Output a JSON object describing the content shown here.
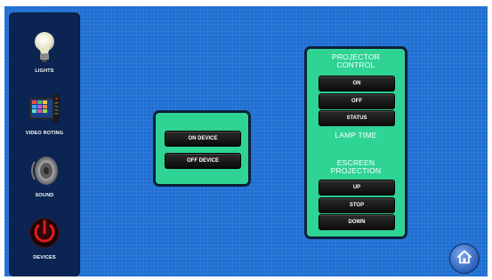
{
  "sidebar": {
    "items": [
      {
        "label": "LIGHTS",
        "icon": "light-bulb-icon"
      },
      {
        "label": "VIDEO ROTING",
        "icon": "tv-remote-icon"
      },
      {
        "label": "SOUND",
        "icon": "speaker-icon"
      },
      {
        "label": "DEVICES",
        "icon": "power-icon"
      }
    ]
  },
  "device_panel": {
    "on_label": "ON DEVICE",
    "off_label": "OFF DEVICE"
  },
  "projector_panel": {
    "title_line1": "PROJECTOR",
    "title_line2": "CONTROL",
    "on_label": "ON",
    "off_label": "OFF",
    "status_label": "STATUS",
    "lamp_time_label": "LAMP TIME",
    "screen_title_line1": "ESCREEN",
    "screen_title_line2": "PROJECTION",
    "up_label": "UP",
    "stop_label": "STOP",
    "down_label": "DOWN"
  },
  "home": {
    "icon": "home-icon"
  },
  "colors": {
    "background": "#1f6fd2",
    "sidebar": "#0b2452",
    "panel": "#2fd394",
    "button": "#111111"
  }
}
